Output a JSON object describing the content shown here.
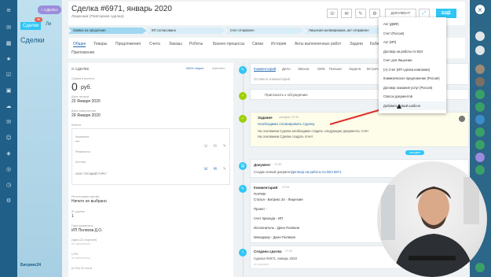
{
  "rail": {
    "icons": [
      "menu-icon",
      "chat-icon",
      "grid-icon",
      "star-icon",
      "tasks-icon",
      "calendar-icon",
      "drive-icon",
      "mail-icon",
      "contacts-icon",
      "sites-icon",
      "crm-icon",
      "time-icon",
      "settings-icon"
    ],
    "badge": "56"
  },
  "list": {
    "title": "Сделки",
    "subtitle": "Ли",
    "button": "+ СДЕЛКА",
    "bottom_logo": "Битрикс24"
  },
  "header": {
    "title": "Сделка #6971, январь 2020",
    "category": "Лицензии (Повторная сделка)",
    "document_button": "ДОКУМЕНТ",
    "save_button": "ЕЩЁ",
    "close_icon": "×"
  },
  "stages": [
    {
      "label": "Заявка на продление",
      "color": "#9fd8f0"
    },
    {
      "label": "КП согласовано",
      "color": "#d7eef8"
    },
    {
      "label": "Счет отправлен",
      "color": "#d7eef8"
    },
    {
      "label": "Лицензия активирована, акт отправлен",
      "color": "#d7eef8"
    }
  ],
  "tabs": [
    "Общее",
    "Товары",
    "Предложения",
    "Счета",
    "Заказы",
    "Роботы",
    "Бизнес-процессы",
    "Связи",
    "История",
    "Акты выполненных работ",
    "Задачи",
    "Кабинет"
  ],
  "tab_row2": "Приложение",
  "left": {
    "section": "О СДЕЛКЕ",
    "open_link": "AD24 открыт",
    "edit": "изменить",
    "sum_label": "Сумма и валюта",
    "sum": "0",
    "currency": "руб.",
    "start_label": "Дата начала",
    "start": "22 Января 2020",
    "close_label": "Дата завершения",
    "close": "29 Января 2020",
    "client_label": "Клиент",
    "company_label": "Компания",
    "company_value": "—",
    "reqs_label": "Реквизиты",
    "contact_label": "Контакт",
    "contact_value": "ООО \"ЛУЧШИЙ-ТУРС\"",
    "source_label": "Регистрация сделки",
    "source": "Ничего не выбрано",
    "group_label": "ID группы",
    "group": "1",
    "resp_label": "Наш реквизиты",
    "resp": "ИП Поляков Д.О.",
    "inn_label": "Идея (24 портале)",
    "inn": "не заполнено",
    "utm_label": "UTM",
    "utm": "не заполнено",
    "extra_label": "(UTM) ID счета",
    "extra": "не заполнено"
  },
  "timeline": {
    "tabs": [
      "Комментарий",
      "Дело",
      "Звонок",
      "SMS",
      "Письмо",
      "Задача",
      "Встреча"
    ],
    "comment_placeholder": "Оставьте комментарий",
    "discuss": "Пригласить к обсуждению",
    "today_badge": "запланированы",
    "task_title": "Задание",
    "task_time": "сегодня, 17:31",
    "task_link": "Необходимо спланировать Сделку",
    "task_line1": "На основании Сделка необходимо создать следующие документы: Счет",
    "task_line2": "На основании Сделки создать отчет",
    "today": "сегодня",
    "doc_title": "Документ",
    "doc_time": "17:32",
    "doc_text": "Создан новый документ",
    "doc_link": "Договор на работы по B24 6971",
    "com_title": "Комментарий",
    "com_time": "17:31",
    "com_lines": [
      "ПАРОВ",
      "Статья - Битрикс 24 - Лицензия",
      "Проект -",
      "Счет прихода - ИП",
      "Исполнитель - Денн Поляков",
      "Менеджер - Денн Поляков"
    ],
    "created_title": "Создана сделка",
    "created_time": "17:31",
    "created_text": "Сделка #6971, январь 2020",
    "created_sub": "не указано"
  },
  "menu": {
    "items": [
      "Акт (ДМФ)",
      "Счет (Россия)",
      "Акт (ИП)",
      "Договор на работы по B24",
      "Счет для Лицензии",
      "(А) Счет (ИП сделка компании)",
      "Коммерческое предложение (Россия)",
      "Договор оказания услуг (Россия)",
      "Список документов",
      "Добавить новый шаблон"
    ],
    "highlighted": 9
  },
  "colors": {
    "accent": "#2fc6f6",
    "green": "#9dcf00",
    "red_arrow": "#e0312f"
  }
}
